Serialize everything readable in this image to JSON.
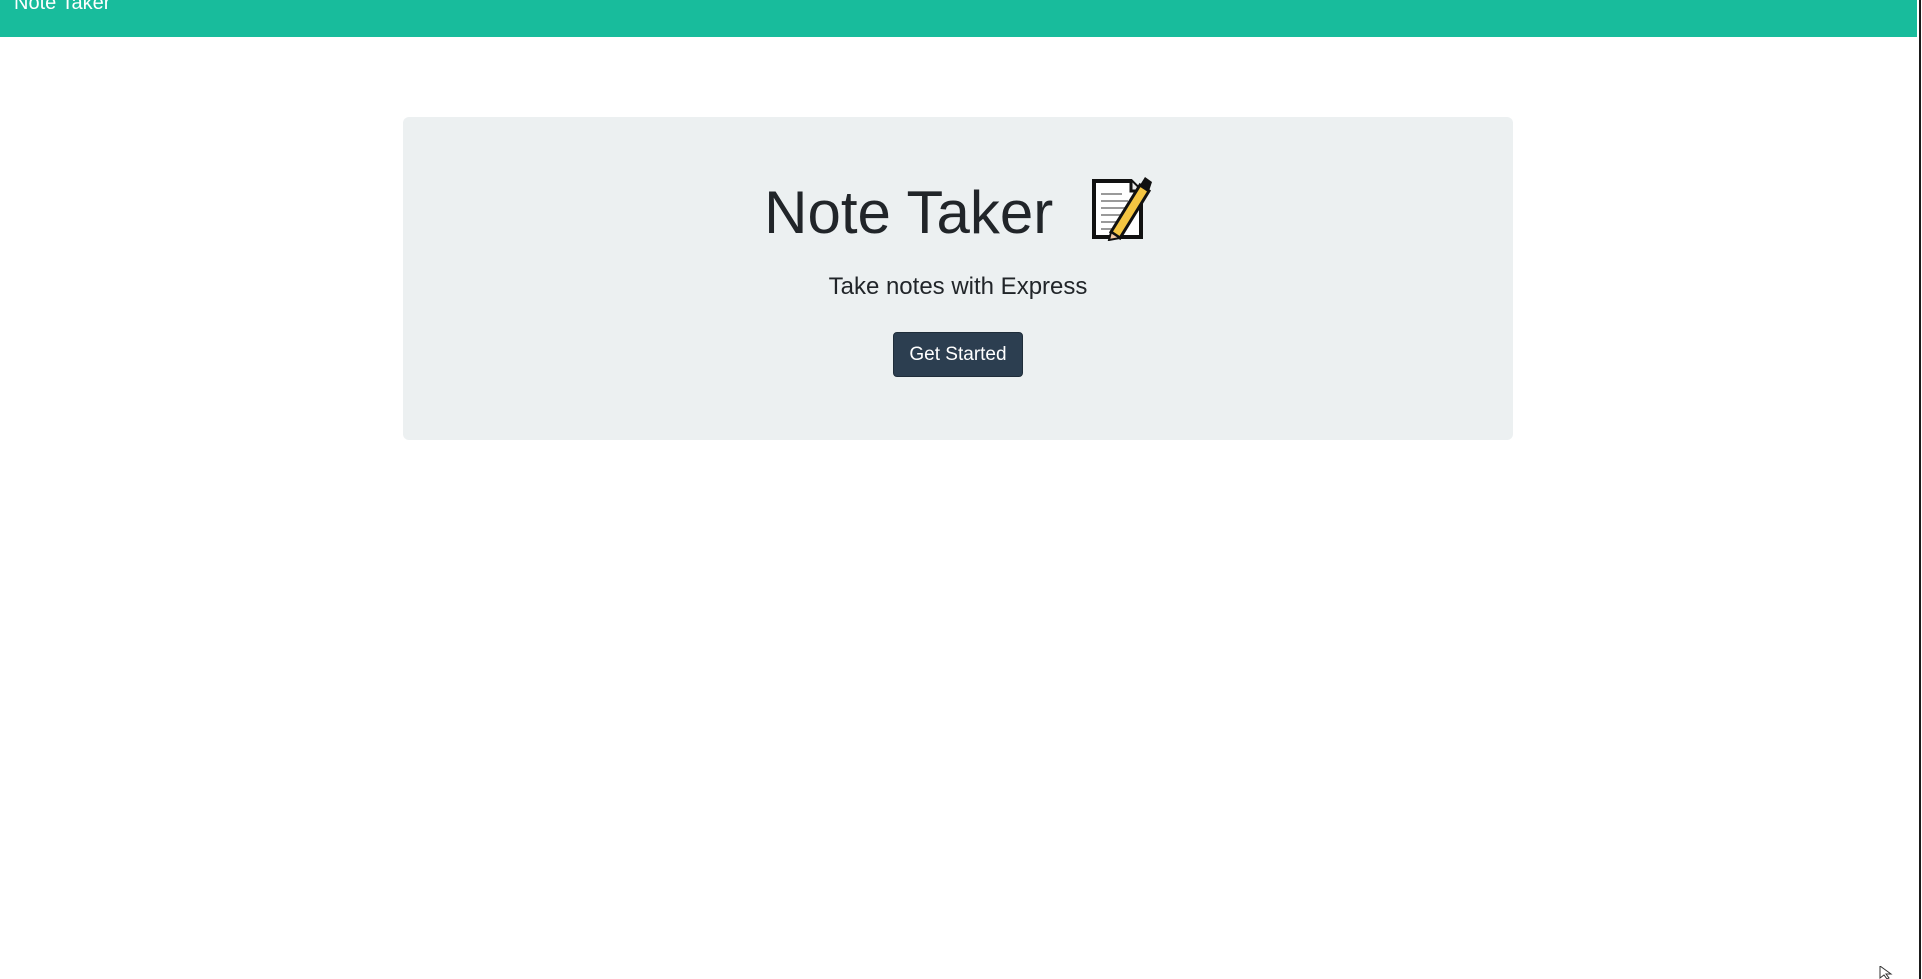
{
  "navbar": {
    "brand": "Note Taker",
    "background": "#18bc9c"
  },
  "hero": {
    "title": "Note Taker",
    "title_icon": "memo-icon",
    "subtitle": "Take notes with Express",
    "button_label": "Get Started",
    "background": "#ecf0f1",
    "button_color": "#2c3e50"
  },
  "pointer": {
    "icon": "mouse-cursor-icon"
  }
}
